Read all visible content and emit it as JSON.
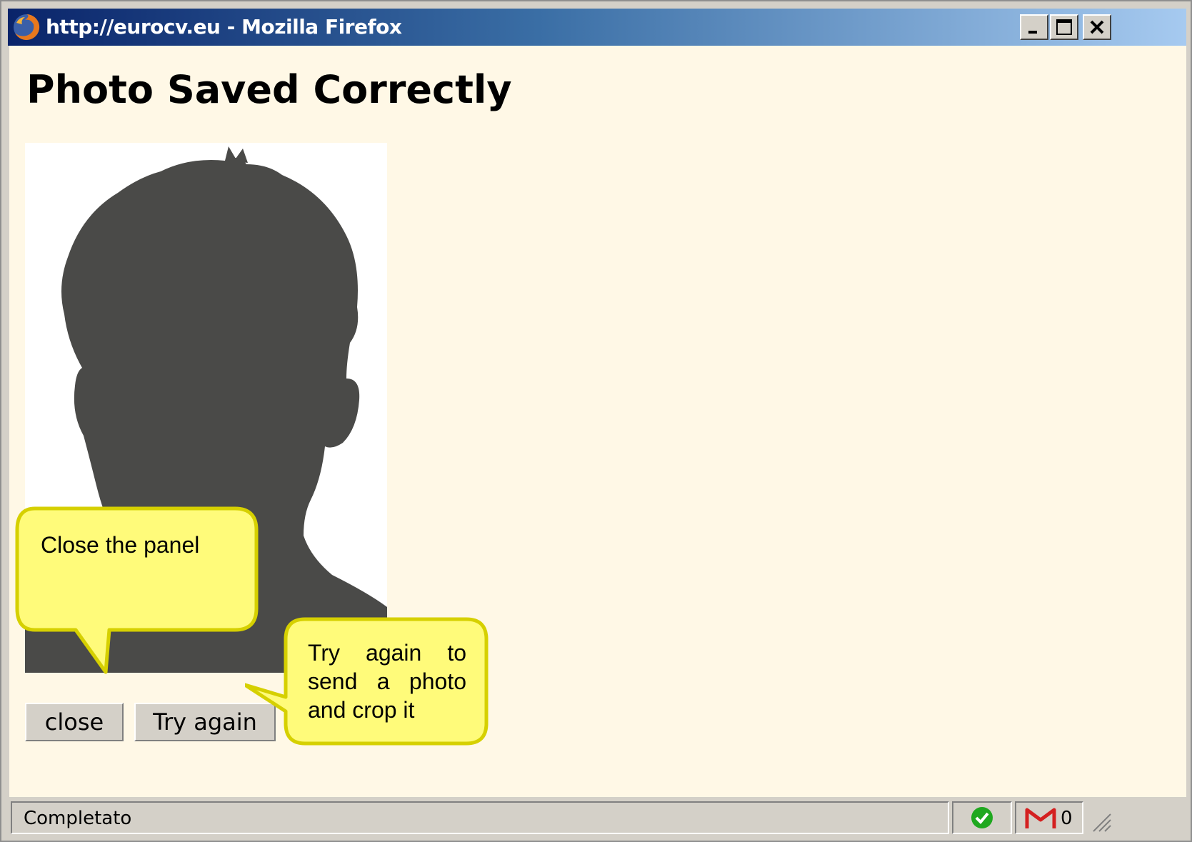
{
  "window": {
    "title": "http://eurocv.eu - Mozilla Firefox",
    "controls": [
      "minimize-icon",
      "maximize-icon",
      "close-icon"
    ],
    "title_gradient": [
      "#0a246a",
      "#a6caf0"
    ]
  },
  "page": {
    "heading": "Photo Saved Correctly",
    "background": "#fff8e6",
    "photo_alt": "profile silhouette placeholder",
    "buttons": {
      "close_label": "close",
      "try_again_label": "Try again"
    }
  },
  "callouts": {
    "close_tip": "Close the panel",
    "try_again_tip_lines": [
      "Try again to",
      "send a photo",
      "and crop it"
    ],
    "fill": "#fffb7a",
    "border": "#d6d000"
  },
  "statusbar": {
    "status_text": "Completato",
    "gmail_count": "0",
    "icons": [
      "check-icon",
      "gmail-icon",
      "resize-grip-icon"
    ]
  }
}
